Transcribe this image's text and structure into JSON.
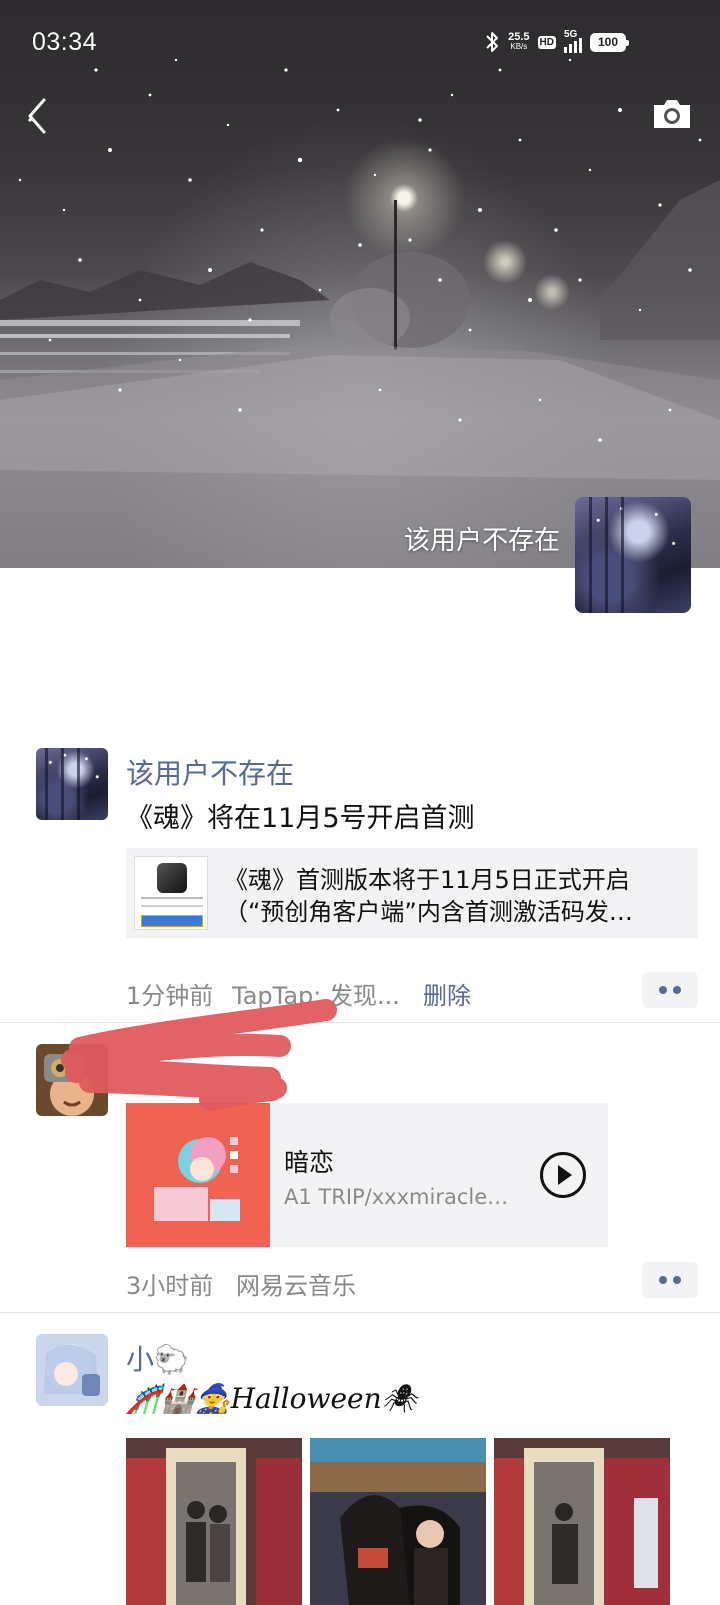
{
  "status_bar": {
    "time": "03:34",
    "net_speed_value": "25.5",
    "net_speed_unit": "KB/s",
    "hd_badge": "HD",
    "network": "5G",
    "battery": "100"
  },
  "header": {
    "back_icon": "chevron-left-icon",
    "camera_icon": "camera-icon"
  },
  "profile": {
    "name": "该用户不存在"
  },
  "posts": [
    {
      "nickname": "该用户不存在",
      "text": "《魂》将在11月5号开启首测",
      "link": {
        "title_line1": "《魂》首测版本将于11月5日正式开启",
        "title_line2": "（“预创角客户端”内含首测激活码发…"
      },
      "time": "1分钟前",
      "source": "TapTap: 发现...",
      "delete_label": "删除"
    },
    {
      "nickname": "",
      "music": {
        "title": "暗恋",
        "artist": "A1 TRIP/xxxmiracle/…"
      },
      "time": "3小时前",
      "source": "网易云音乐"
    },
    {
      "nickname": "小🐑",
      "text_emojis": "🎢🏰🧙",
      "text": "Halloween",
      "text_tail_emoji": "🕷"
    }
  ],
  "colors": {
    "nickname": "#576b95",
    "meta": "#8a8a8a",
    "redaction": "#e05a5e",
    "music_cover": "#f06352"
  }
}
